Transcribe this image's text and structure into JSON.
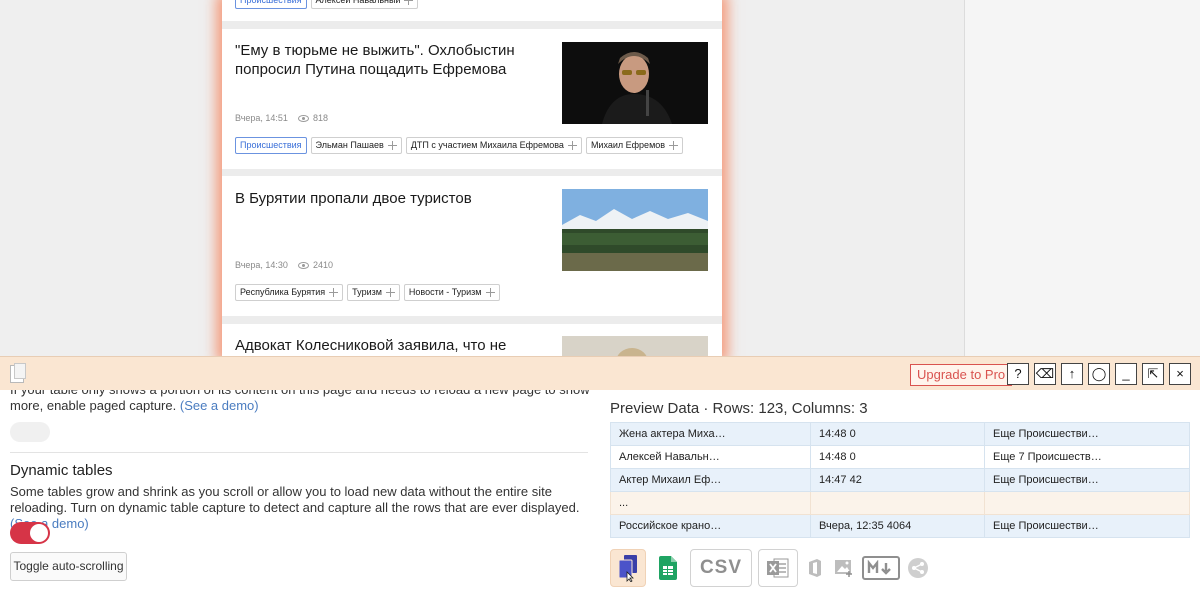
{
  "news": {
    "card0_tags": [
      {
        "label": "Происшествия",
        "primary": true
      },
      {
        "label": "Алексей Навальный",
        "primary": false
      }
    ],
    "cards": [
      {
        "title": "\"Ему в тюрьме не выжить\". Охлобыстин попросил Путина пощадить Ефремова",
        "time": "Вчера, 14:51",
        "views": "818",
        "tags": [
          {
            "label": "Происшествия",
            "primary": true
          },
          {
            "label": "Эльман Пашаев",
            "primary": false
          },
          {
            "label": "ДТП с участием Михаила Ефремова",
            "primary": false
          },
          {
            "label": "Михаил Ефремов",
            "primary": false
          }
        ]
      },
      {
        "title": "В Бурятии пропали двое туристов",
        "time": "Вчера, 14:30",
        "views": "2410",
        "tags": [
          {
            "label": "Республика Бурятия",
            "primary": false
          },
          {
            "label": "Туризм",
            "primary": false
          },
          {
            "label": "Новости - Туризм",
            "primary": false
          }
        ]
      },
      {
        "title": "Адвокат Колесниковой заявила, что не знает о"
      }
    ]
  },
  "extension": {
    "upgrade_label": "Upgrade to Pro",
    "toolbar_buttons": [
      "?",
      "⌫",
      "↑",
      "◯",
      "_",
      "⇱",
      "×"
    ],
    "paged_text": "If your table only shows a portion of its content on this page and needs to reload a new page to show more, enable paged capture.",
    "see_demo": "(See a demo)",
    "dynamic_title": "Dynamic tables",
    "dynamic_text": "Some tables grow and shrink as you scroll or allow you to load new data without the entire site reloading. Turn on dynamic table capture to detect and capture all the rows that are ever displayed.",
    "dynamic_toggle_on": true,
    "auto_scroll_label": "Toggle auto-scrolling",
    "preview_title": "Preview Data · Rows: 123, Columns: 3",
    "rows": [
      [
        "Жена актера Миха…",
        "14:48 0",
        "Еще Происшестви…"
      ],
      [
        "Алексей Навальн…",
        "14:48 0",
        "Еще 7 Происшеств…"
      ],
      [
        "Актер Михаил Еф…",
        "14:47 42",
        "Еще Происшестви…"
      ],
      [
        "...",
        "",
        ""
      ],
      [
        "Российское крано…",
        "Вчера, 12:35 4064",
        "Еще Происшестви…"
      ]
    ],
    "csv_label": "CSV",
    "colors": {
      "accent": "#d63447",
      "toolbar": "#fae6d2",
      "row_stripe": "#e8f1fa"
    }
  }
}
